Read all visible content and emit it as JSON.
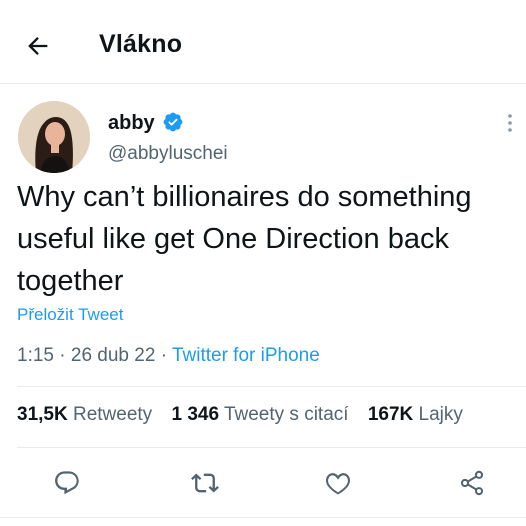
{
  "header": {
    "title": "Vlákno",
    "back_icon": "arrow-left-icon"
  },
  "tweet": {
    "author_name": "abby",
    "author_handle": "@abbyluschei",
    "verified_icon": "verified-badge-icon",
    "text": "Why can’t billionaires do something useful like get One Direction back together",
    "translate_label": "Přeložit Tweet",
    "time": "1:15",
    "date": "26 dub 22",
    "separator": "·",
    "source": "Twitter for iPhone"
  },
  "stats": {
    "retweets_count": "31,5K",
    "retweets_label": "Retweety",
    "quotes_count": "1 346",
    "quotes_label": "Tweety s citací",
    "likes_count": "167K",
    "likes_label": "Lajky"
  },
  "actions": [
    "reply-icon",
    "retweet-icon",
    "like-icon",
    "share-icon"
  ],
  "colors": {
    "accent": "#1d9bf0",
    "text": "#0f1419",
    "secondary": "#536471",
    "border": "#e6ecf0"
  }
}
